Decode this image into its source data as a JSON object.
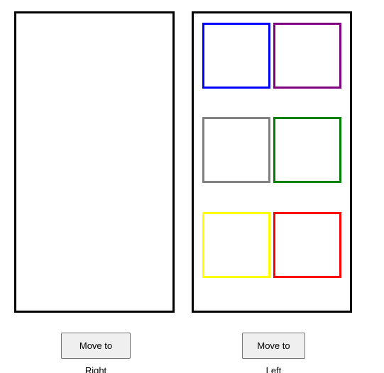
{
  "buttons": {
    "move_right_label": "Move to Right",
    "move_left_label": "Move to Left"
  },
  "right_container": {
    "boxes": [
      {
        "color": "#0000ff"
      },
      {
        "color": "#800080"
      },
      {
        "color": "#808080"
      },
      {
        "color": "#008000"
      },
      {
        "color": "#ffff00"
      },
      {
        "color": "#ff0000"
      }
    ]
  }
}
